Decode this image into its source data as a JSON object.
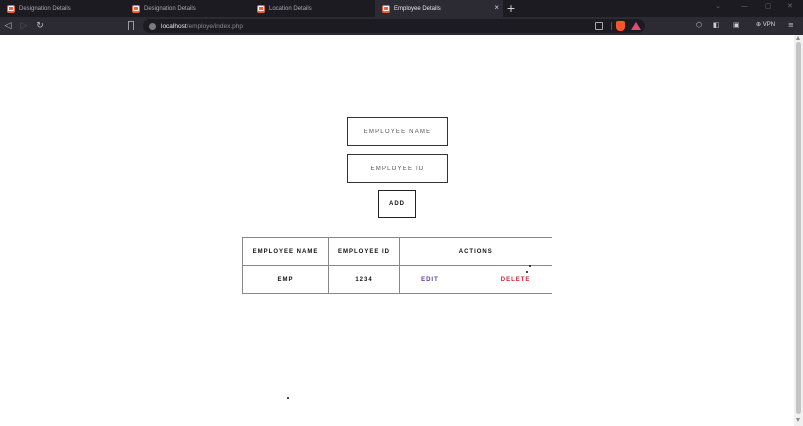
{
  "browser": {
    "tabs": [
      {
        "title": "Designation Details",
        "active": false
      },
      {
        "title": "Designation Details",
        "active": false
      },
      {
        "title": "Location Details",
        "active": false
      },
      {
        "title": "Employee Details",
        "active": true
      }
    ],
    "new_tab_label": "+",
    "close_label": "×",
    "url_host": "localhost",
    "url_path": "/employe/index.php",
    "vpn_label": "VPN"
  },
  "form": {
    "name_placeholder": "EMPLOYEE NAME",
    "id_placeholder": "EMPLOYEE ID",
    "add_label": "ADD"
  },
  "table": {
    "headers": [
      "EMPLOYEE NAME",
      "EMPLOYEE ID",
      "ACTIONS"
    ],
    "rows": [
      {
        "name": "EMP",
        "id": "1234",
        "edit_label": "EDIT",
        "delete_label": "DELETE"
      }
    ]
  },
  "colors": {
    "edit_link": "#5b3a9c",
    "delete_link": "#d2202f",
    "tab_favicon": "#e8643b"
  }
}
